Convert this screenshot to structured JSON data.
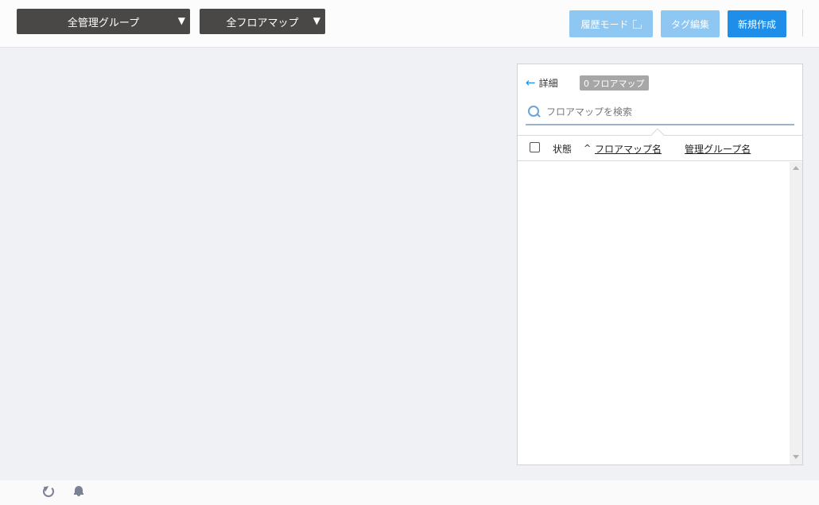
{
  "toolbar": {
    "group_dropdown": {
      "label": "全管理グループ",
      "arrow": "▼"
    },
    "floor_dropdown": {
      "label": "全フロアマップ",
      "arrow": "▼"
    },
    "history_label": "履歴モード",
    "tag_label": "タグ編集",
    "new_label": "新規作成"
  },
  "panel": {
    "detail_label": "詳細",
    "back_icon": "←",
    "count_badge": "0 フロアマップ",
    "search": {
      "placeholder": "フロアマップを検索",
      "value": ""
    },
    "columns": {
      "status": "状態",
      "sort_indicator": "^",
      "floor_map_name": "フロアマップ名",
      "group_name": "管理グループ名"
    },
    "rows": []
  },
  "footer": {
    "icons": [
      "refresh-icon",
      "bell-icon"
    ]
  },
  "colors": {
    "primary": "#1e8ee9",
    "primary_disabled": "#8ec7f1",
    "dropdown_bg": "#4a4846",
    "page_bg": "#f0f1f5"
  }
}
